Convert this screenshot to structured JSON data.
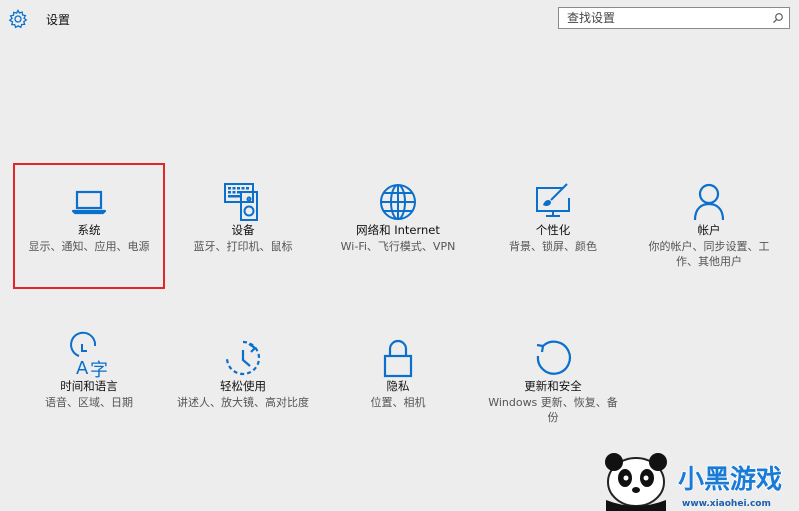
{
  "header": {
    "title": "设置",
    "search_placeholder": "查找设置"
  },
  "tiles": [
    {
      "name": "系统",
      "desc": "显示、通知、应用、电源",
      "icon": "laptop-icon"
    },
    {
      "name": "设备",
      "desc": "蓝牙、打印机、鼠标",
      "icon": "keyboard-speaker-icon"
    },
    {
      "name": "网络和 Internet",
      "desc": "Wi-Fi、飞行模式、VPN",
      "icon": "globe-icon"
    },
    {
      "name": "个性化",
      "desc": "背景、锁屏、颜色",
      "icon": "paint-monitor-icon"
    },
    {
      "name": "帐户",
      "desc": "你的帐户、同步设置、工作、其他用户",
      "icon": "person-icon"
    },
    {
      "name": "时间和语言",
      "desc": "语音、区域、日期",
      "icon": "time-language-icon"
    },
    {
      "name": "轻松使用",
      "desc": "讲述人、放大镜、高对比度",
      "icon": "ease-of-access-icon"
    },
    {
      "name": "隐私",
      "desc": "位置、相机",
      "icon": "lock-icon"
    },
    {
      "name": "更新和安全",
      "desc": "Windows 更新、恢复、备份",
      "icon": "refresh-icon"
    }
  ],
  "watermark": {
    "text": "小黑游戏",
    "url": "www.xiaohei.com"
  },
  "colors": {
    "accent": "#0b6fcc",
    "selection_border": "#e3262b",
    "background": "#ededed"
  }
}
